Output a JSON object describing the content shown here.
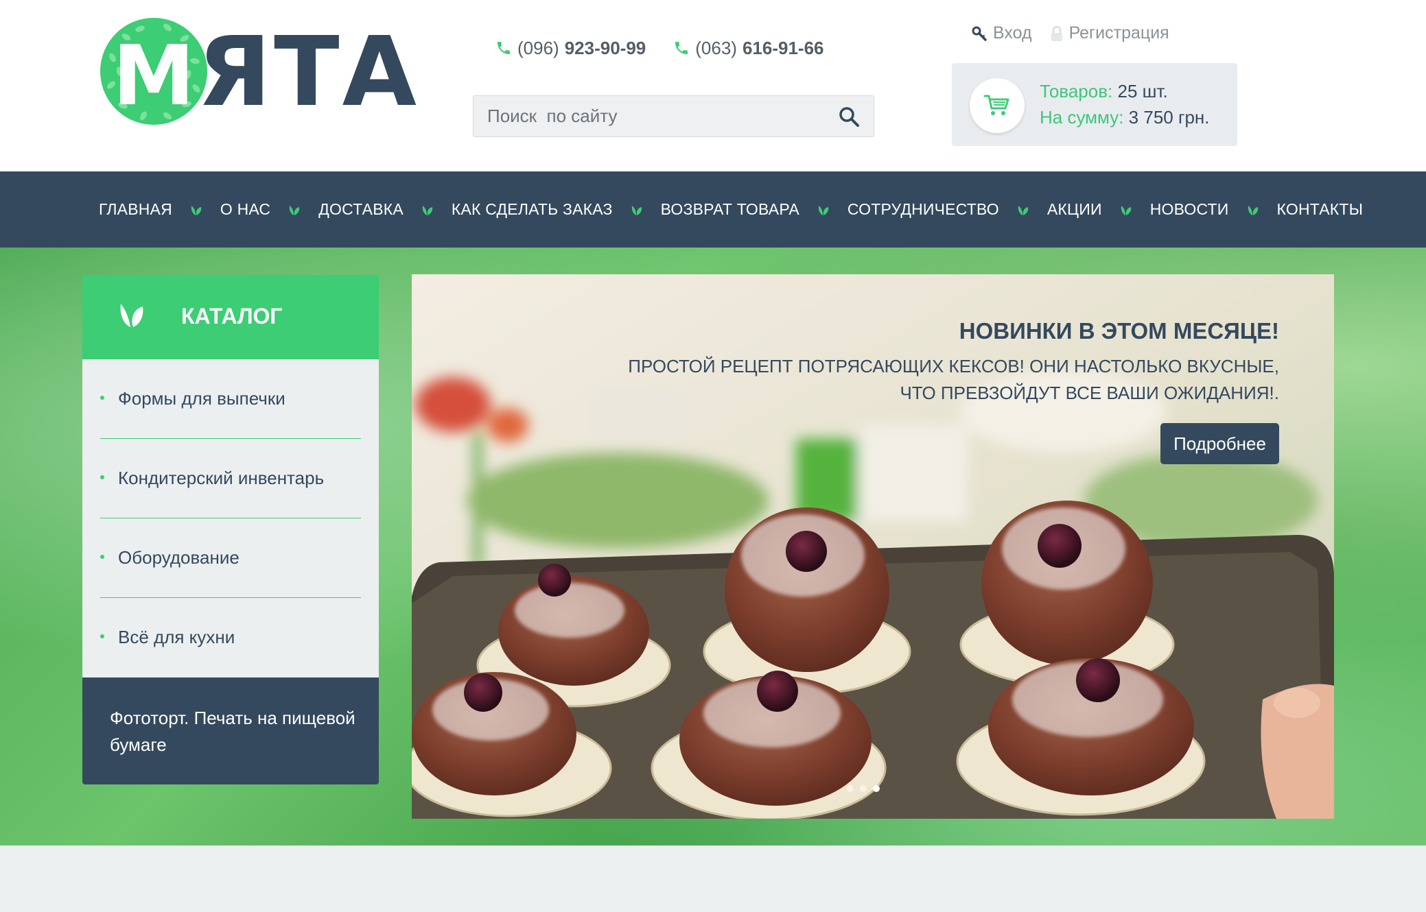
{
  "logo": {
    "text": "МЯТА",
    "icon": "mint-leaf-circle-logo"
  },
  "colors": {
    "brand_green": "#3ccd75",
    "dark": "#34495e",
    "light_gray": "#eceff0"
  },
  "phones": [
    {
      "code": "(096)",
      "number": "923-90-99",
      "icon": "phone-icon"
    },
    {
      "code": "(063)",
      "number": "616-91-66",
      "icon": "phone-icon"
    }
  ],
  "search": {
    "placeholder": "Поиск  по сайту",
    "value": "",
    "icon": "search-icon"
  },
  "auth": {
    "login": "Вход",
    "register": "Регистрация"
  },
  "cart": {
    "items_label": "Товаров:",
    "items_value": "25 шт.",
    "sum_label": "На сумму:",
    "sum_value": "3 750 грн.",
    "icon": "cart-icon"
  },
  "nav": {
    "items": [
      "ГЛАВНАЯ",
      "О НАС",
      "ДОСТАВКА",
      "КАК СДЕЛАТЬ ЗАКАЗ",
      "ВОЗВРАТ ТОВАРА",
      "СОТРУДНИЧЕСТВО",
      "АКЦИИ",
      "НОВОСТИ",
      "КОНТАКТЫ"
    ],
    "separator_icon": "leaf-icon"
  },
  "catalog": {
    "title": "КАТАЛОГ",
    "items": [
      "Формы для выпечки",
      "Кондитерский инвентарь",
      "Оборудование",
      "Всё для кухни"
    ],
    "extra": "Фототорт. Печать на пищевой бумаге"
  },
  "slider": {
    "title": "НОВИНКИ В ЭТОМ МЕСЯЦЕ!",
    "text": "ПРОСТОЙ РЕЦЕПТ ПОТРЯСАЮЩИХ КЕКСОВ! ОНИ НАСТОЛЬКО ВКУСНЫЕ, ЧТО ПРЕВЗОЙДУТ ВСЕ ВАШИ ОЖИДАНИЯ!.",
    "button": "Подробнее",
    "slides_count": 3,
    "active_slide": 3
  }
}
